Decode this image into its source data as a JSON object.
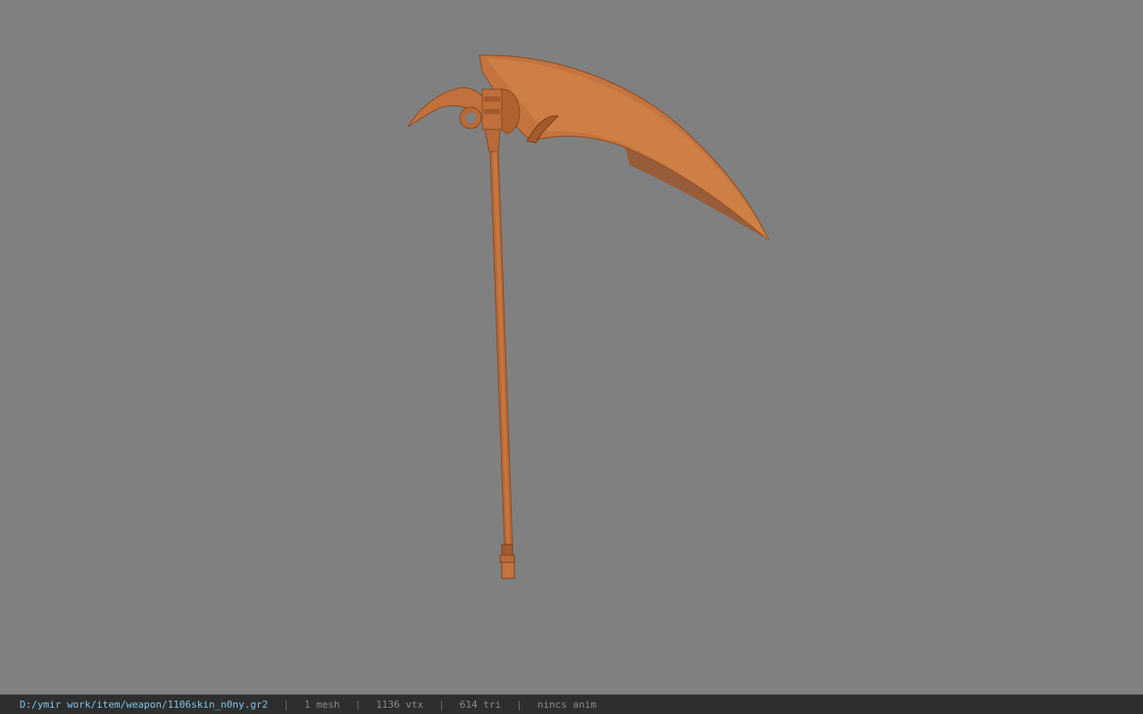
{
  "viewport": {
    "background_color": "#808080",
    "model": {
      "description_icon": "scythe-model",
      "color_base": "#b86a38",
      "color_light": "#cf8048",
      "color_dark": "#8a4a22"
    }
  },
  "status_bar": {
    "file_path": "D:/ymir work/item/weapon/1106skin_n0ny.gr2",
    "separator": "|",
    "mesh_count": "1 mesh",
    "vertex_count": "1136 vtx",
    "triangle_count": "614 tri",
    "anim_status": "nincs anim",
    "path_color": "#7fc4e8",
    "text_color": "#8a8a8a"
  }
}
